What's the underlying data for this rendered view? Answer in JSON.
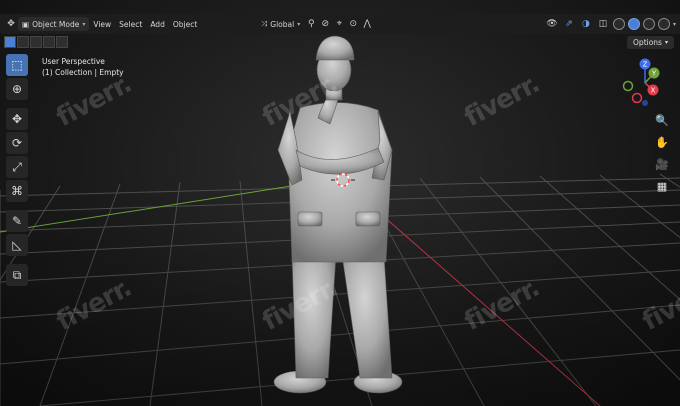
{
  "header": {
    "mode_label": "Object Mode",
    "menus": [
      "View",
      "Select",
      "Add",
      "Object"
    ],
    "transform_orientation": "Global"
  },
  "options_label": "Options",
  "overlay": {
    "view_name": "User Perspective",
    "collection_info": "(1) Collection | Empty"
  },
  "gizmo": {
    "axes": [
      {
        "label": "Z",
        "color": "#3b6ff0"
      },
      {
        "label": "Y",
        "color": "#6fa43a"
      },
      {
        "label": "X",
        "color": "#e23b4c"
      }
    ]
  },
  "toolbar": {
    "tools": [
      "select-box",
      "cursor",
      "move",
      "rotate",
      "scale",
      "transform",
      "annotate",
      "measure",
      "add-cube"
    ]
  },
  "watermark_text": "fiverr.",
  "colors": {
    "accent": "#4772b3",
    "header_bg": "#1d1d1d",
    "axis_x": "#c8384a",
    "axis_y": "#6aa83a"
  }
}
